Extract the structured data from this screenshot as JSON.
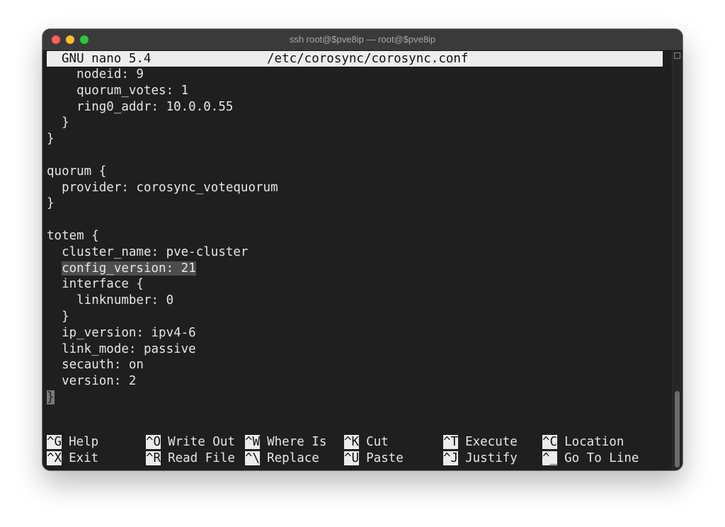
{
  "window": {
    "title": "ssh root@$pve8ip — root@$pve8ip"
  },
  "nano": {
    "version": "GNU nano 5.4",
    "filename": "/etc/corosync/corosync.conf"
  },
  "lines": [
    "    nodeid: 9",
    "    quorum_votes: 1",
    "    ring0_addr: 10.0.0.55",
    "  }",
    "}",
    "",
    "quorum {",
    "  provider: corosync_votequorum",
    "}",
    "",
    "totem {",
    "  cluster_name: pve-cluster",
    "  config_version: 21",
    "  interface {",
    "    linknumber: 0",
    "  }",
    "  ip_version: ipv4-6",
    "  link_mode: passive",
    "  secauth: on",
    "  version: 2",
    "}"
  ],
  "highlight": {
    "line_index": 12,
    "indent": "  ",
    "text": "config_version: 21"
  },
  "cursor": {
    "line_index": 20,
    "char": "}"
  },
  "shortcuts": [
    {
      "key": "^G",
      "label": "Help"
    },
    {
      "key": "^O",
      "label": "Write Out"
    },
    {
      "key": "^W",
      "label": "Where Is"
    },
    {
      "key": "^K",
      "label": "Cut"
    },
    {
      "key": "^T",
      "label": "Execute"
    },
    {
      "key": "^C",
      "label": "Location"
    },
    {
      "key": "^X",
      "label": "Exit"
    },
    {
      "key": "^R",
      "label": "Read File"
    },
    {
      "key": "^\\",
      "label": "Replace"
    },
    {
      "key": "^U",
      "label": "Paste"
    },
    {
      "key": "^J",
      "label": "Justify"
    },
    {
      "key": "^_",
      "label": "Go To Line"
    }
  ]
}
